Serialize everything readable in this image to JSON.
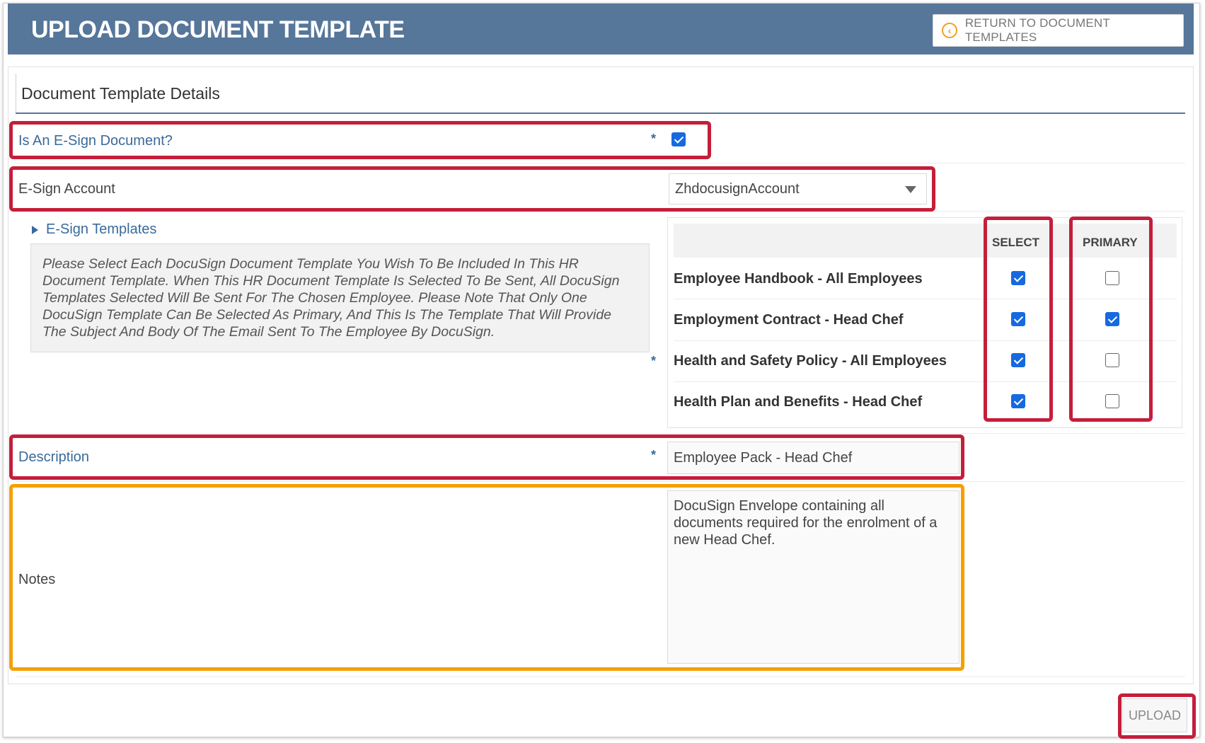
{
  "header": {
    "title": "UPLOAD DOCUMENT TEMPLATE",
    "return_label": "RETURN TO DOCUMENT TEMPLATES"
  },
  "section": {
    "title": "Document Template Details"
  },
  "form": {
    "esign_question": {
      "label": "Is An E-Sign Document?",
      "checked": true
    },
    "esign_account": {
      "label": "E-Sign Account",
      "value": "ZhdocusignAccount"
    },
    "esign_templates": {
      "label": "E-Sign Templates",
      "info": "Please Select Each DocuSign Document Template You Wish To Be Included In This HR Document Template. When This HR Document Template Is Selected To Be Sent, All DocuSign Templates Selected Will Be Sent For The Chosen Employee. Please Note That Only One DocuSign Template Can Be Selected As Primary, And This Is The Template That Will Provide The Subject And Body Of The Email Sent To The Employee By DocuSign.",
      "col_select": "SELECT",
      "col_primary": "PRIMARY",
      "rows": [
        {
          "name": "Employee Handbook - All Employees",
          "select": true,
          "primary": false
        },
        {
          "name": "Employment Contract - Head Chef",
          "select": true,
          "primary": true
        },
        {
          "name": "Health and Safety Policy - All Employees",
          "select": true,
          "primary": false
        },
        {
          "name": "Health Plan and Benefits - Head Chef",
          "select": true,
          "primary": false
        }
      ]
    },
    "description": {
      "label": "Description",
      "value": "Employee Pack - Head Chef"
    },
    "notes": {
      "label": "Notes",
      "value": "DocuSign Envelope containing all documents required for the enrolment of a new Head Chef."
    },
    "required_mark": "*"
  },
  "footer": {
    "upload_label": "UPLOAD"
  },
  "colors": {
    "header": "#56769a",
    "highlight_red": "#c41e3a",
    "highlight_orange": "#f5a000",
    "checkbox": "#1769e0"
  }
}
